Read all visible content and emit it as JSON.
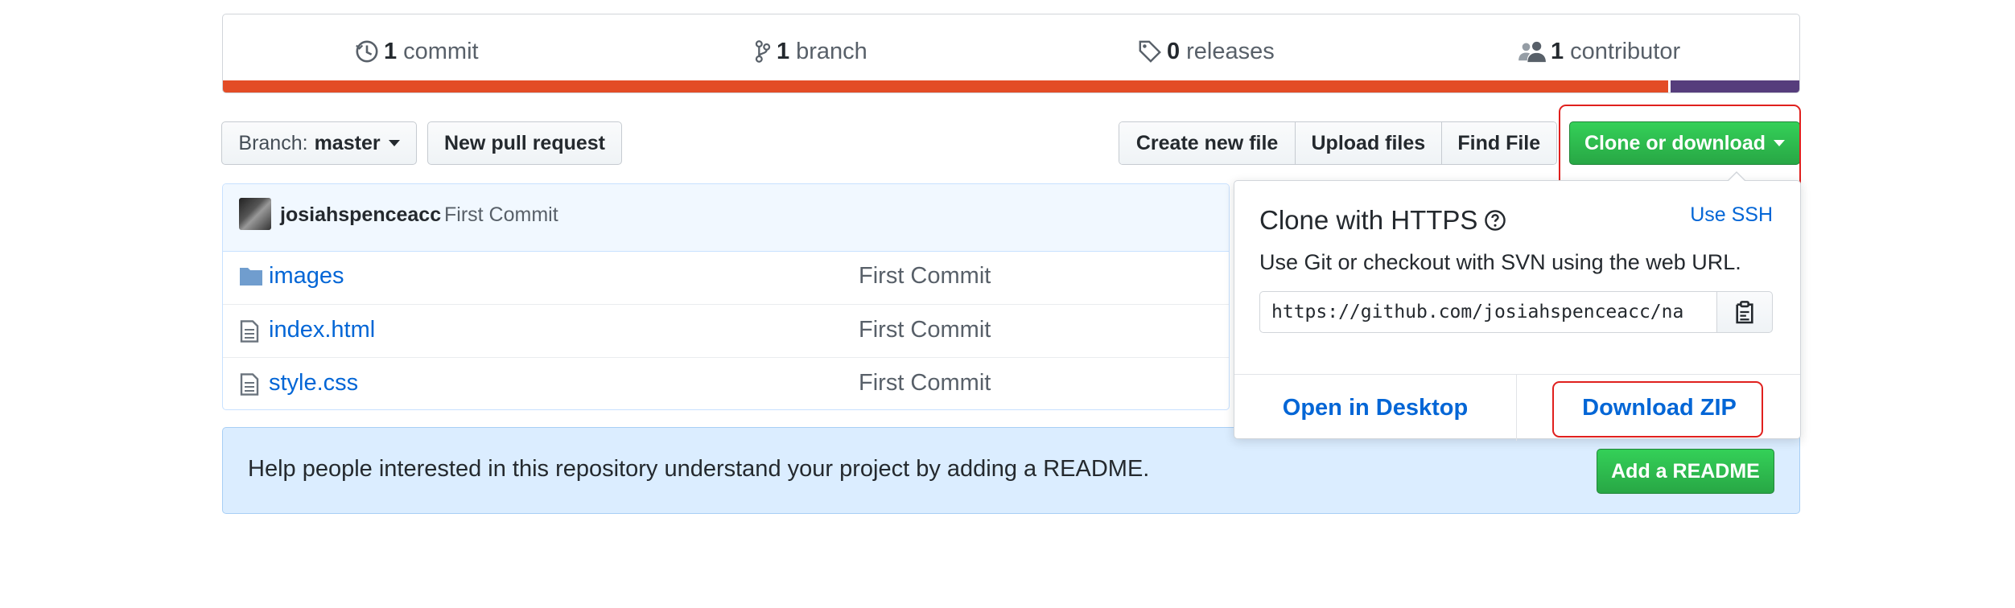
{
  "summary": {
    "commits": {
      "count": "1",
      "label": "commit"
    },
    "branches": {
      "count": "1",
      "label": "branch"
    },
    "releases": {
      "count": "0",
      "label": "releases"
    },
    "contributors": {
      "count": "1",
      "label": "contributor"
    },
    "language_bar": [
      {
        "fraction": 0.918,
        "color": "#e34c26"
      },
      {
        "fraction": 0.082,
        "color": "#563d7c"
      }
    ]
  },
  "toolbar": {
    "branch_prefix": "Branch:",
    "branch_name": "master",
    "new_pull_request": "New pull request",
    "create_new_file": "Create new file",
    "upload_files": "Upload files",
    "find_file": "Find File",
    "clone_or_download": "Clone or download"
  },
  "commit": {
    "author": "josiahspenceacc",
    "message": "First Commit"
  },
  "files": [
    {
      "name": "images",
      "type": "folder",
      "message": "First Commit"
    },
    {
      "name": "index.html",
      "type": "file",
      "message": "First Commit"
    },
    {
      "name": "style.css",
      "type": "file",
      "message": "First Commit"
    }
  ],
  "readme": {
    "text": "Help people interested in this repository understand your project by adding a README.",
    "button": "Add a README"
  },
  "clone_popover": {
    "title": "Clone with HTTPS",
    "use_ssh": "Use SSH",
    "description": "Use Git or checkout with SVN using the web URL.",
    "url": "https://github.com/josiahspenceacc/na",
    "open_in_desktop": "Open in Desktop",
    "download_zip": "Download ZIP"
  },
  "colors": {
    "accent_green": "#28a745",
    "link_blue": "#0366d6",
    "highlight_red": "#e0201e"
  }
}
